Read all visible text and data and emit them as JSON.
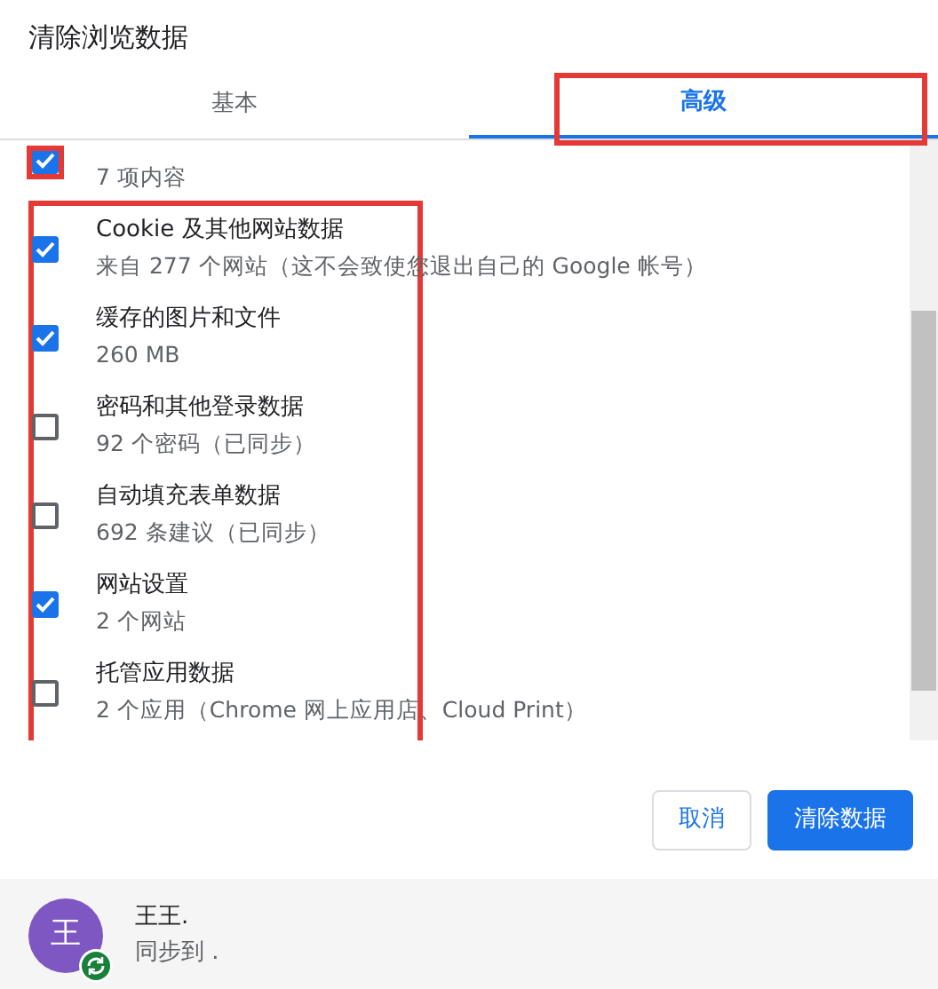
{
  "dialog": {
    "title": "清除浏览数据"
  },
  "tabs": [
    {
      "label": "基本",
      "selected": false,
      "highlighted": false
    },
    {
      "label": "高级",
      "selected": true,
      "highlighted": true
    }
  ],
  "items": [
    {
      "detail": "7 项内容",
      "checked": true,
      "checkbox_framed": true
    },
    {
      "title": "Cookie 及其他网站数据",
      "detail": "来自 277 个网站（这不会致使您退出自己的 Google 帐号）",
      "checked": true
    },
    {
      "title": "缓存的图片和文件",
      "detail": "260 MB",
      "checked": true
    },
    {
      "title": "密码和其他登录数据",
      "detail": "92 个密码（已同步）",
      "checked": false
    },
    {
      "title": "自动填充表单数据",
      "detail": "692 条建议（已同步）",
      "checked": false
    },
    {
      "title": "网站设置",
      "detail": "2 个网站",
      "checked": true
    },
    {
      "title": "托管应用数据",
      "detail": "2 个应用（Chrome 网上应用店、Cloud Print）",
      "checked": false
    }
  ],
  "list_framed": true,
  "buttons": [
    {
      "label": "取消",
      "kind": "secondary"
    },
    {
      "label": "清除数据",
      "kind": "primary"
    }
  ],
  "account": {
    "avatar": "王",
    "name": "王王.",
    "sync": "同步到 ."
  }
}
